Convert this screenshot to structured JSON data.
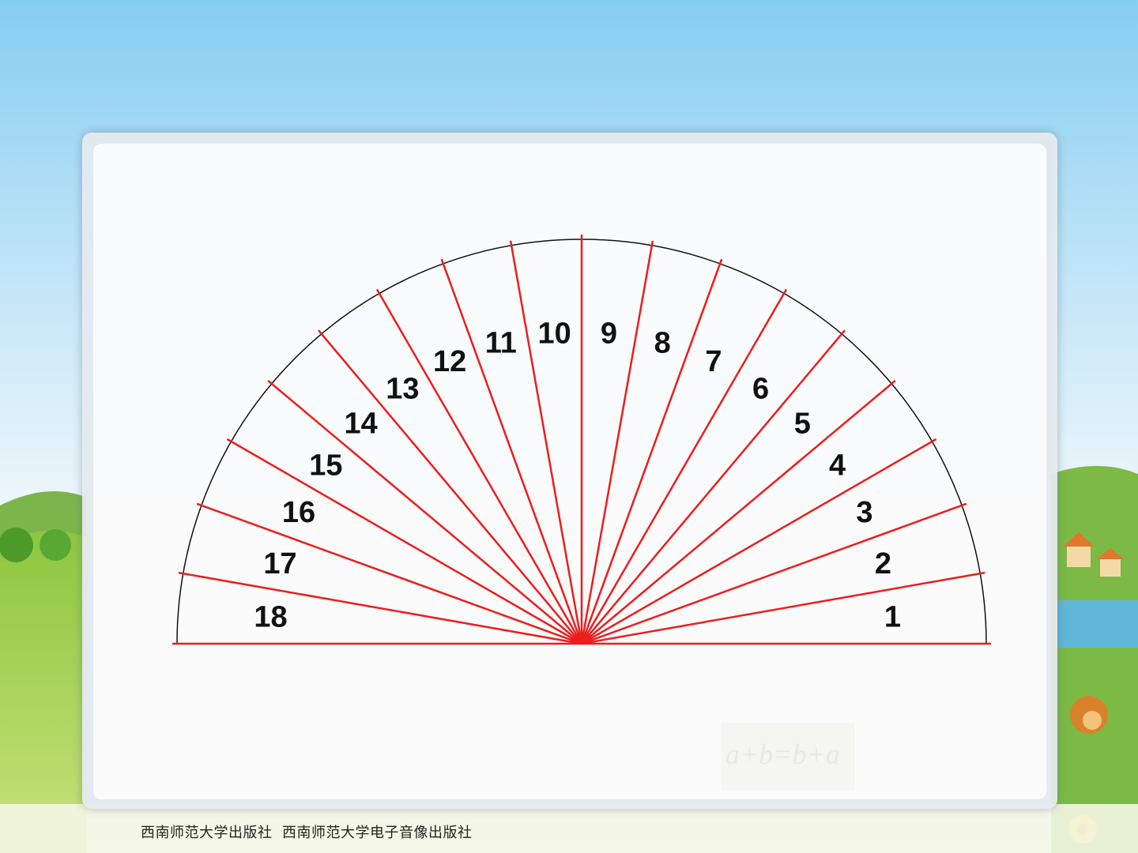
{
  "protractor": {
    "segments": 18,
    "labels": [
      "1",
      "2",
      "3",
      "4",
      "5",
      "6",
      "7",
      "8",
      "9",
      "10",
      "11",
      "12",
      "13",
      "14",
      "15",
      "16",
      "17",
      "18"
    ],
    "line_color": "#ee1c1c",
    "arc_color": "#111111"
  },
  "background": {
    "sky_top": "#8fd0f3",
    "sky_mid": "#cfeaf8",
    "panel_color": "#ffffff",
    "watermark_formula": "a+b=b+a"
  },
  "footer": {
    "publisher1": "西南师范大学出版社",
    "publisher2": "西南师范大学电子音像出版社"
  }
}
